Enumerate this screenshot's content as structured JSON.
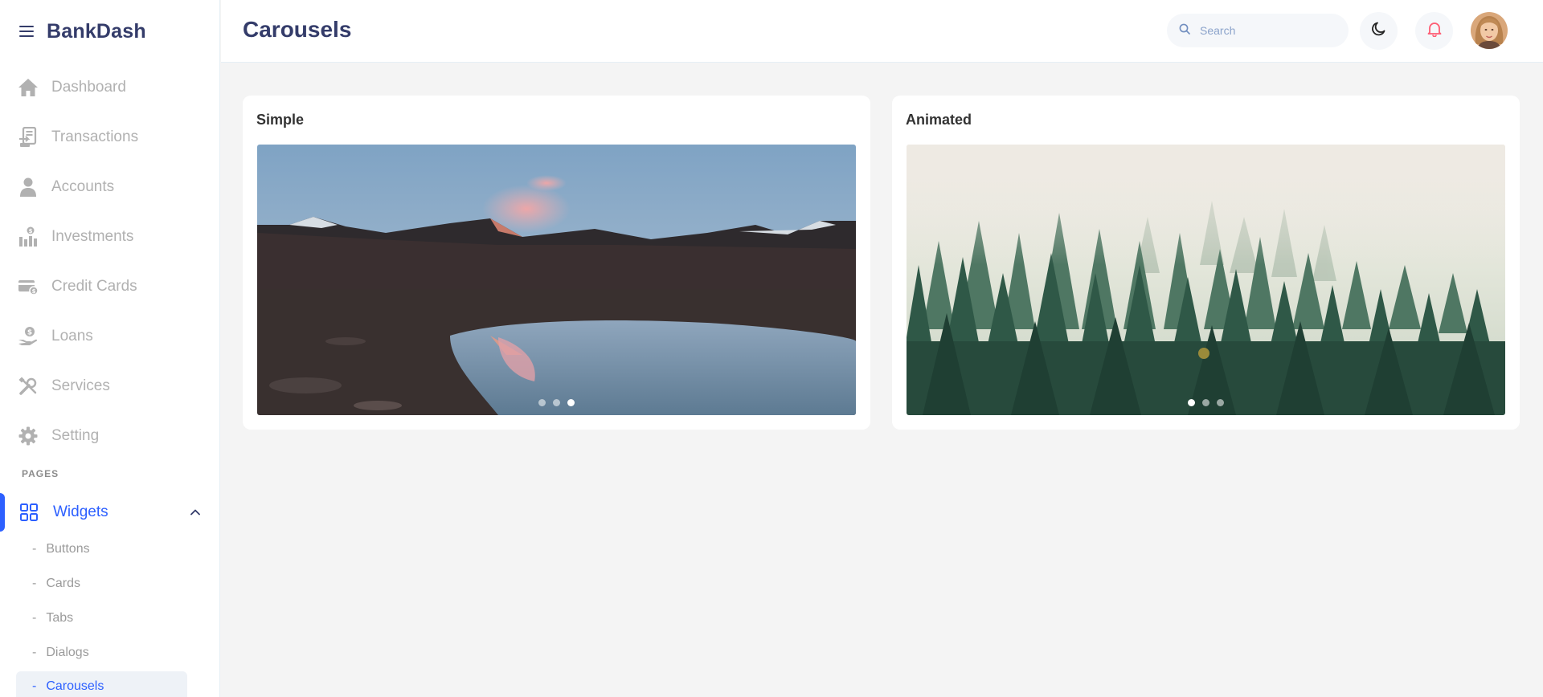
{
  "app": {
    "brand": "BankDash"
  },
  "sidebar": {
    "items": [
      {
        "label": "Dashboard",
        "icon": "home-icon"
      },
      {
        "label": "Transactions",
        "icon": "transfer-icon"
      },
      {
        "label": "Accounts",
        "icon": "user-icon"
      },
      {
        "label": "Investments",
        "icon": "investment-icon"
      },
      {
        "label": "Credit Cards",
        "icon": "credit-card-icon"
      },
      {
        "label": "Loans",
        "icon": "loan-icon"
      },
      {
        "label": "Services",
        "icon": "services-icon"
      },
      {
        "label": "Setting",
        "icon": "gear-icon"
      }
    ],
    "section_label": "PAGES",
    "widgets": {
      "label": "Widgets",
      "icon": "grid-icon"
    },
    "subitems": [
      {
        "label": "Buttons"
      },
      {
        "label": "Cards"
      },
      {
        "label": "Tabs"
      },
      {
        "label": "Dialogs"
      },
      {
        "label": "Carousels",
        "active": true
      }
    ]
  },
  "header": {
    "title": "Carousels",
    "search_placeholder": "Search"
  },
  "cards": [
    {
      "title": "Simple",
      "image": "mountain-lake-photo",
      "slides": 3,
      "active_slide": 3
    },
    {
      "title": "Animated",
      "image": "misty-forest-photo",
      "slides": 3,
      "active_slide": 1
    }
  ],
  "colors": {
    "accent": "#2d60ff",
    "text_dark": "#343c6a",
    "text_muted": "#b1b1b1",
    "background": "#f4f4f4",
    "bell": "#fe5c73"
  }
}
